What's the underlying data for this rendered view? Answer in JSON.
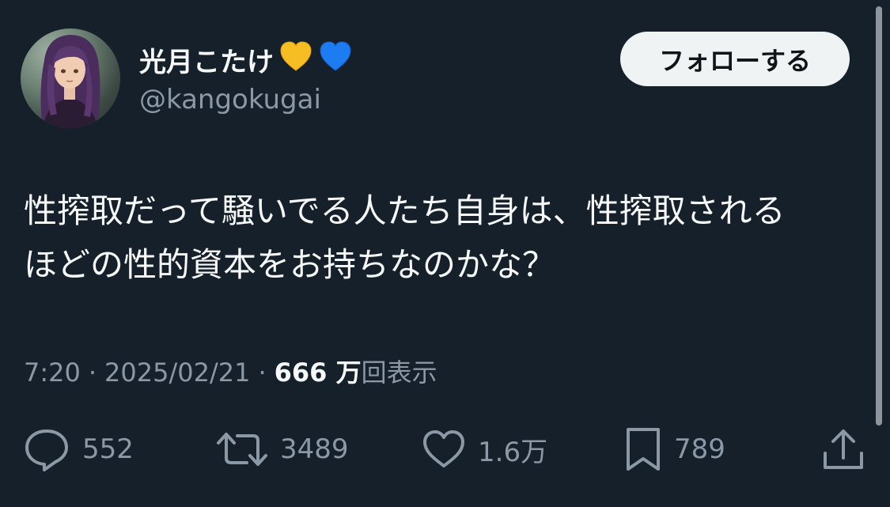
{
  "author": {
    "display_name": "光月こたけ",
    "handle": "@kangokugai",
    "badges": [
      "yellow-heart-icon",
      "blue-heart-icon"
    ]
  },
  "follow_button": {
    "label": "フォローする"
  },
  "tweet": {
    "text_lines": [
      "性搾取だって騒いでる人たち自身は、性搾取される",
      "ほどの性的資本をお持ちなのかな？"
    ],
    "time": "7:20",
    "date": "2025/02/21",
    "separator": "·",
    "views_count": "666 万",
    "views_label": "回表示"
  },
  "actions": {
    "reply": {
      "icon": "reply-icon",
      "count": "552"
    },
    "retweet": {
      "icon": "retweet-icon",
      "count": "3489"
    },
    "like": {
      "icon": "like-icon",
      "count": "1.6万"
    },
    "bookmark": {
      "icon": "bookmark-icon",
      "count": "789"
    },
    "share": {
      "icon": "share-icon"
    }
  },
  "colors": {
    "background": "#15202b",
    "primary_text": "#f7f9f9",
    "secondary_text": "#8b98a5",
    "follow_button_bg": "#eff3f4",
    "yellow_heart": "#f7be24",
    "blue_heart": "#1d7cf2"
  }
}
